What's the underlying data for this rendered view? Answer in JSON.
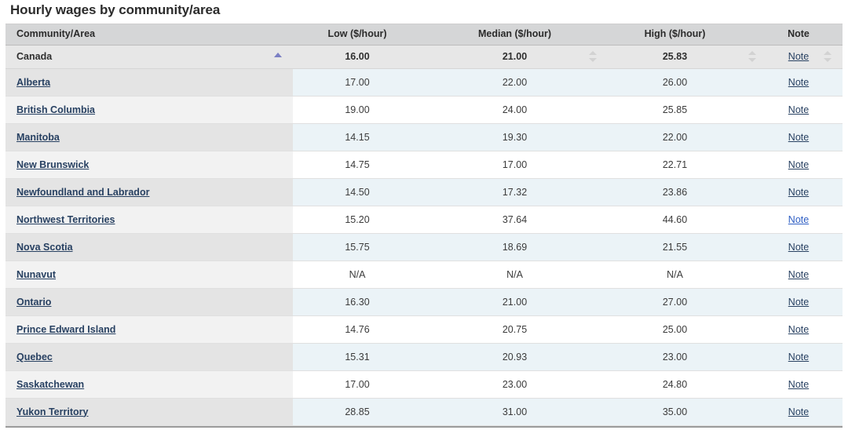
{
  "title": "Hourly wages by community/area",
  "colors": {
    "link": "#284162",
    "link_highlight": "#2f5fc4",
    "header_bg": "#d5d6d7",
    "summary_bg": "#e7e7e7",
    "stripe_area_odd": "#e4e4e4",
    "stripe_area_even": "#f2f2f2",
    "stripe_data_odd": "#ebf3f7",
    "stripe_data_even": "#ffffff",
    "sort_active": "#7b7fc4",
    "sort_inactive": "#d2d2d2"
  },
  "table": {
    "columns": [
      {
        "key": "area",
        "label": "Community/Area",
        "align": "left"
      },
      {
        "key": "low",
        "label": "Low ($/hour)",
        "align": "center"
      },
      {
        "key": "median",
        "label": "Median ($/hour)",
        "align": "center"
      },
      {
        "key": "high",
        "label": "High ($/hour)",
        "align": "center"
      },
      {
        "key": "note",
        "label": "Note",
        "align": "center"
      }
    ],
    "sort": {
      "area_state": "ascending",
      "low_state": "none",
      "median_state": "none",
      "high_state": "none",
      "note_state": "none",
      "active_column": "Community/Area"
    },
    "summary_row": {
      "area": "Canada",
      "low": "16.00",
      "median": "21.00",
      "high": "25.83",
      "note": "Note"
    },
    "note_label": "Note",
    "rows": [
      {
        "area": "Alberta",
        "low": "17.00",
        "median": "22.00",
        "high": "26.00",
        "note": "Note",
        "note_highlight": false
      },
      {
        "area": "British Columbia",
        "low": "19.00",
        "median": "24.00",
        "high": "25.85",
        "note": "Note",
        "note_highlight": false
      },
      {
        "area": "Manitoba",
        "low": "14.15",
        "median": "19.30",
        "high": "22.00",
        "note": "Note",
        "note_highlight": false
      },
      {
        "area": "New Brunswick",
        "low": "14.75",
        "median": "17.00",
        "high": "22.71",
        "note": "Note",
        "note_highlight": false
      },
      {
        "area": "Newfoundland and Labrador",
        "low": "14.50",
        "median": "17.32",
        "high": "23.86",
        "note": "Note",
        "note_highlight": false
      },
      {
        "area": "Northwest Territories",
        "low": "15.20",
        "median": "37.64",
        "high": "44.60",
        "note": "Note",
        "note_highlight": true
      },
      {
        "area": "Nova Scotia",
        "low": "15.75",
        "median": "18.69",
        "high": "21.55",
        "note": "Note",
        "note_highlight": false
      },
      {
        "area": "Nunavut",
        "low": "N/A",
        "median": "N/A",
        "high": "N/A",
        "note": "Note",
        "note_highlight": false
      },
      {
        "area": "Ontario",
        "low": "16.30",
        "median": "21.00",
        "high": "27.00",
        "note": "Note",
        "note_highlight": false
      },
      {
        "area": "Prince Edward Island",
        "low": "14.76",
        "median": "20.75",
        "high": "25.00",
        "note": "Note",
        "note_highlight": false
      },
      {
        "area": "Quebec",
        "low": "15.31",
        "median": "20.93",
        "high": "23.00",
        "note": "Note",
        "note_highlight": false
      },
      {
        "area": "Saskatchewan",
        "low": "17.00",
        "median": "23.00",
        "high": "24.80",
        "note": "Note",
        "note_highlight": false
      },
      {
        "area": "Yukon Territory",
        "low": "28.85",
        "median": "31.00",
        "high": "35.00",
        "note": "Note",
        "note_highlight": false
      }
    ]
  }
}
